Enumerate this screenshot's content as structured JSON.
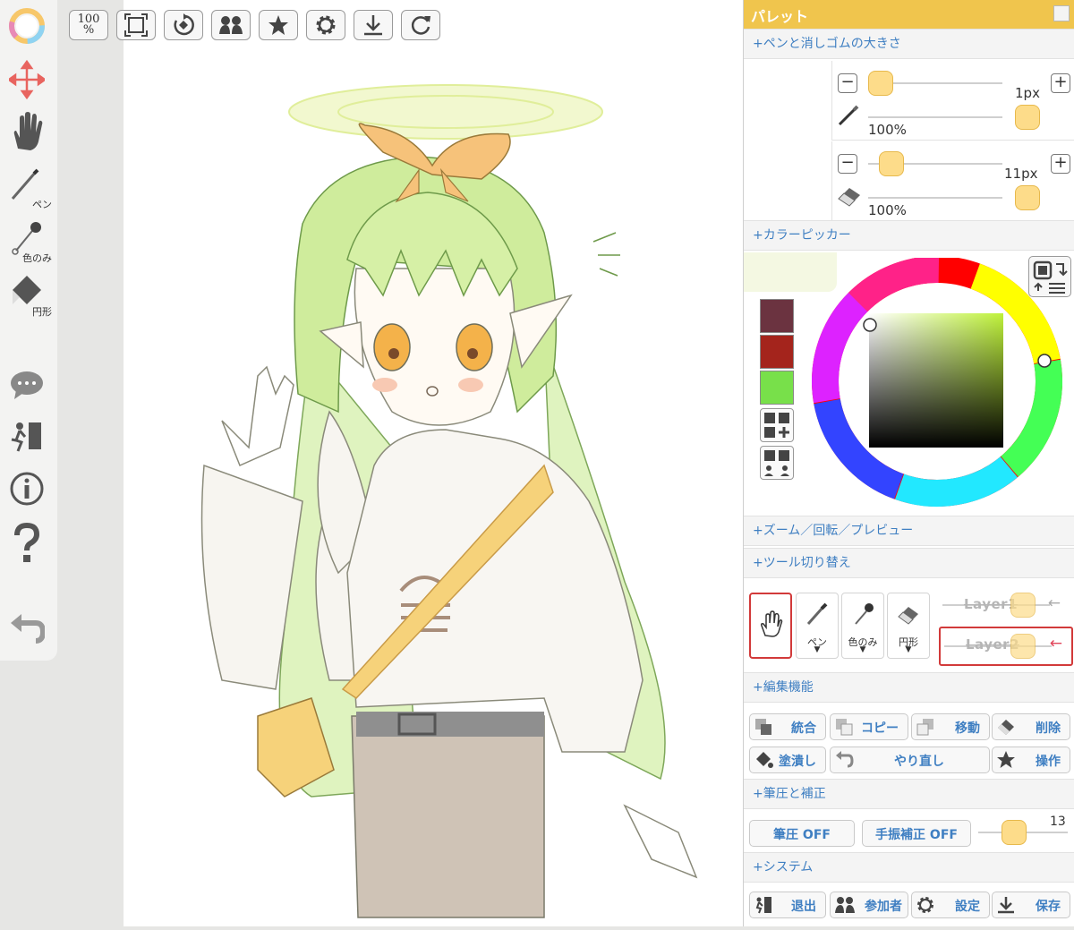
{
  "left_toolbar": {
    "pen_label": "ペン",
    "eyedropper_label": "色のみ",
    "shape_label": "円形"
  },
  "top_toolbar": {
    "zoom_top": "100",
    "zoom_bottom": "%"
  },
  "palette": {
    "title": "パレット",
    "sections": {
      "brush_size": "+ペンと消しゴムの大きさ",
      "color_picker": "+カラーピッカー",
      "zoom": "+ズーム／回転／プレビュー",
      "tool_switch": "+ツール切り替え",
      "edit": "+編集機能",
      "pressure": "+筆圧と補正",
      "system": "+システム"
    },
    "pen": {
      "size": "1px",
      "opacity": "100%"
    },
    "eraser": {
      "size": "11px",
      "opacity": "100%"
    },
    "swatches": [
      "#6b3340",
      "#a4241c",
      "#78e04a"
    ],
    "picker": {
      "hue": "#bff23a"
    },
    "tools": {
      "pen": "ペン",
      "eyedropper": "色のみ",
      "shape": "円形"
    },
    "layers": [
      {
        "name": "Layer",
        "num": "1"
      },
      {
        "name": "Layer",
        "num": "2"
      }
    ],
    "edit_actions": {
      "merge": "統合",
      "copy": "コピー",
      "move": "移動",
      "delete": "削除",
      "fill": "塗潰し",
      "redo": "やり直し",
      "operate": "操作"
    },
    "pressure": {
      "pressure_btn": "筆圧 OFF",
      "stabilizer_btn": "手振補正 OFF",
      "value": "13"
    },
    "system": {
      "exit": "退出",
      "participants": "参加者",
      "settings": "設定",
      "save": "保存"
    }
  },
  "colors": {
    "accent": "#f0c54d",
    "link_blue": "#3f7fc2",
    "knob": "#fddc8a"
  }
}
